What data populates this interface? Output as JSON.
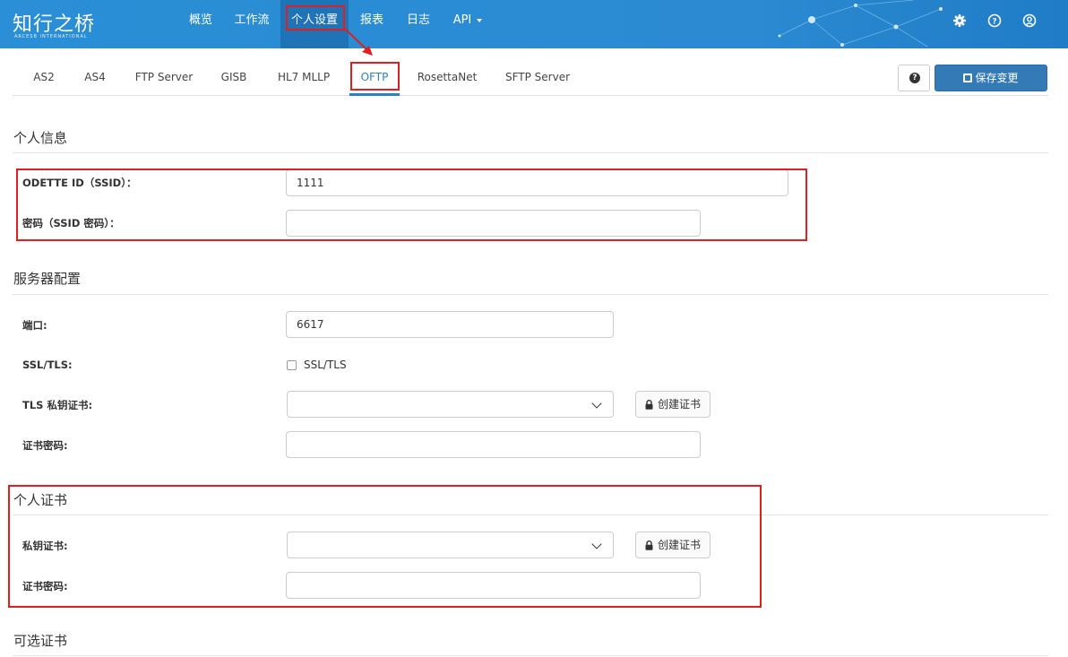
{
  "topbar": {
    "logo_text": "知行之桥",
    "logo_sub": "ARCESB INTERNATIONAL",
    "nav": [
      {
        "label": "概览"
      },
      {
        "label": "工作流"
      },
      {
        "label": "个人设置"
      },
      {
        "label": "报表"
      },
      {
        "label": "日志"
      },
      {
        "label": "API"
      }
    ],
    "icons": [
      "gear-icon",
      "help-icon",
      "user-icon"
    ]
  },
  "tabs": [
    {
      "label": "AS2"
    },
    {
      "label": "AS4"
    },
    {
      "label": "FTP Server"
    },
    {
      "label": "GISB"
    },
    {
      "label": "HL7 MLLP"
    },
    {
      "label": "OFTP"
    },
    {
      "label": "RosettaNet"
    },
    {
      "label": "SFTP Server"
    }
  ],
  "actions": {
    "help_label": "?",
    "save_label": "保存变更"
  },
  "personal_info": {
    "title": "个人信息",
    "odette_label": "ODETTE ID（SSID）：",
    "odette_value": "1111",
    "password_label": "密码（SSID 密码）：",
    "password_value": ""
  },
  "server_config": {
    "title": "服务器配置",
    "port_label": "端口:",
    "port_value": "6617",
    "ssl_label": "SSL/TLS:",
    "ssl_checkbox_label": "SSL/TLS",
    "ssl_checked": false,
    "tls_key_label": "TLS 私钥证书:",
    "create_cert_label": "创建证书",
    "cert_password_label": "证书密码:"
  },
  "personal_cert": {
    "title": "个人证书",
    "private_key_label": "私钥证书:",
    "create_cert_label": "创建证书",
    "cert_password_label": "证书密码:"
  },
  "optional_cert": {
    "title": "可选证书"
  },
  "colors": {
    "brand": "#2a8fd6",
    "accent": "#337ab7",
    "annotation": "#e02020",
    "active_tab": "#2d7fc4"
  }
}
